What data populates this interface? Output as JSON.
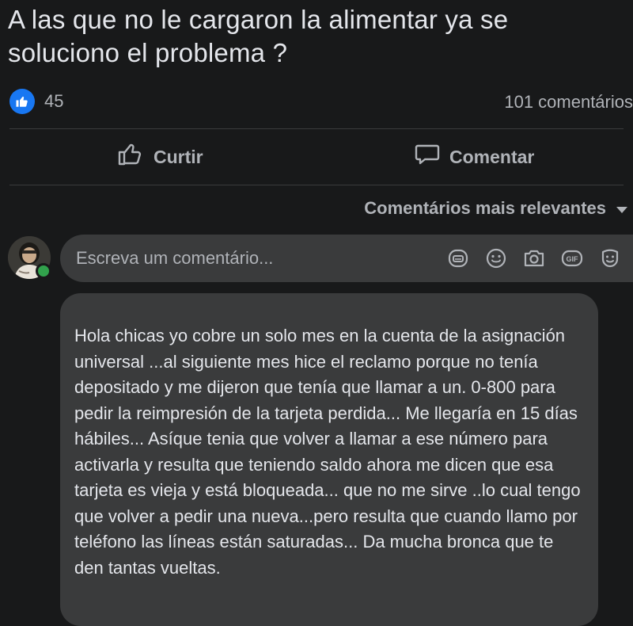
{
  "post": {
    "title": "A las que no le cargaron la alimentar ya se soluciono el problema ?",
    "reactions_count": "45",
    "comments_count": "101 comentários"
  },
  "actions": {
    "like_label": "Curtir",
    "comment_label": "Comentar"
  },
  "sort": {
    "label": "Comentários mais relevantes"
  },
  "composer": {
    "placeholder": "Escreva um comentário...",
    "icons": [
      "sticker-icon",
      "emoji-icon",
      "camera-icon",
      "gif-icon",
      "avatar-sticker-icon"
    ]
  },
  "comment": {
    "text": "Hola chicas yo cobre un solo mes en la cuenta de la asignación universal ...al siguiente mes hice el reclamo porque no tenía depositado y me dijeron que tenía que llamar a un. 0-800 para pedir la reimpresión de la tarjeta perdida... Me llegaría en 15 días hábiles... Asíque tenia que volver a llamar a ese número para activarla y resulta que teniendo saldo ahora me dicen que esa tarjeta es vieja y está bloqueada... que no me sirve ..lo cual tengo que volver a pedir una nueva...pero resulta que cuando llamo por teléfono las líneas están saturadas... Da mucha bronca que te den tantas vueltas."
  },
  "colors": {
    "background": "#18191a",
    "surface": "#3a3b3c",
    "text_primary": "#e4e6eb",
    "text_secondary": "#b0b3b8",
    "like_blue": "#1877f2",
    "online_green": "#31a24c"
  }
}
